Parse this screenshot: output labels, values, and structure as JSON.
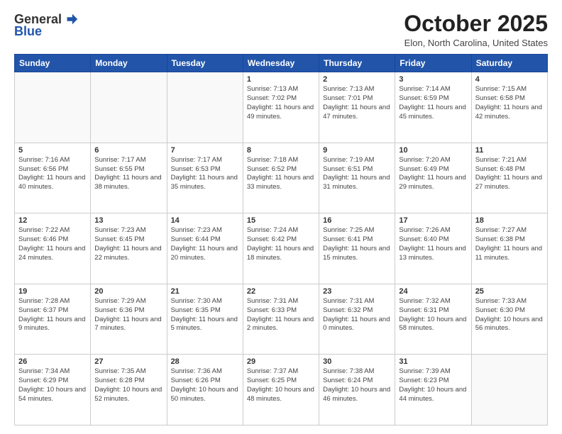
{
  "logo": {
    "line1": "General",
    "line2": "Blue"
  },
  "header": {
    "month": "October 2025",
    "location": "Elon, North Carolina, United States"
  },
  "days_of_week": [
    "Sunday",
    "Monday",
    "Tuesday",
    "Wednesday",
    "Thursday",
    "Friday",
    "Saturday"
  ],
  "weeks": [
    [
      {
        "day": "",
        "info": ""
      },
      {
        "day": "",
        "info": ""
      },
      {
        "day": "",
        "info": ""
      },
      {
        "day": "1",
        "info": "Sunrise: 7:13 AM\nSunset: 7:02 PM\nDaylight: 11 hours and 49 minutes."
      },
      {
        "day": "2",
        "info": "Sunrise: 7:13 AM\nSunset: 7:01 PM\nDaylight: 11 hours and 47 minutes."
      },
      {
        "day": "3",
        "info": "Sunrise: 7:14 AM\nSunset: 6:59 PM\nDaylight: 11 hours and 45 minutes."
      },
      {
        "day": "4",
        "info": "Sunrise: 7:15 AM\nSunset: 6:58 PM\nDaylight: 11 hours and 42 minutes."
      }
    ],
    [
      {
        "day": "5",
        "info": "Sunrise: 7:16 AM\nSunset: 6:56 PM\nDaylight: 11 hours and 40 minutes."
      },
      {
        "day": "6",
        "info": "Sunrise: 7:17 AM\nSunset: 6:55 PM\nDaylight: 11 hours and 38 minutes."
      },
      {
        "day": "7",
        "info": "Sunrise: 7:17 AM\nSunset: 6:53 PM\nDaylight: 11 hours and 35 minutes."
      },
      {
        "day": "8",
        "info": "Sunrise: 7:18 AM\nSunset: 6:52 PM\nDaylight: 11 hours and 33 minutes."
      },
      {
        "day": "9",
        "info": "Sunrise: 7:19 AM\nSunset: 6:51 PM\nDaylight: 11 hours and 31 minutes."
      },
      {
        "day": "10",
        "info": "Sunrise: 7:20 AM\nSunset: 6:49 PM\nDaylight: 11 hours and 29 minutes."
      },
      {
        "day": "11",
        "info": "Sunrise: 7:21 AM\nSunset: 6:48 PM\nDaylight: 11 hours and 27 minutes."
      }
    ],
    [
      {
        "day": "12",
        "info": "Sunrise: 7:22 AM\nSunset: 6:46 PM\nDaylight: 11 hours and 24 minutes."
      },
      {
        "day": "13",
        "info": "Sunrise: 7:23 AM\nSunset: 6:45 PM\nDaylight: 11 hours and 22 minutes."
      },
      {
        "day": "14",
        "info": "Sunrise: 7:23 AM\nSunset: 6:44 PM\nDaylight: 11 hours and 20 minutes."
      },
      {
        "day": "15",
        "info": "Sunrise: 7:24 AM\nSunset: 6:42 PM\nDaylight: 11 hours and 18 minutes."
      },
      {
        "day": "16",
        "info": "Sunrise: 7:25 AM\nSunset: 6:41 PM\nDaylight: 11 hours and 15 minutes."
      },
      {
        "day": "17",
        "info": "Sunrise: 7:26 AM\nSunset: 6:40 PM\nDaylight: 11 hours and 13 minutes."
      },
      {
        "day": "18",
        "info": "Sunrise: 7:27 AM\nSunset: 6:38 PM\nDaylight: 11 hours and 11 minutes."
      }
    ],
    [
      {
        "day": "19",
        "info": "Sunrise: 7:28 AM\nSunset: 6:37 PM\nDaylight: 11 hours and 9 minutes."
      },
      {
        "day": "20",
        "info": "Sunrise: 7:29 AM\nSunset: 6:36 PM\nDaylight: 11 hours and 7 minutes."
      },
      {
        "day": "21",
        "info": "Sunrise: 7:30 AM\nSunset: 6:35 PM\nDaylight: 11 hours and 5 minutes."
      },
      {
        "day": "22",
        "info": "Sunrise: 7:31 AM\nSunset: 6:33 PM\nDaylight: 11 hours and 2 minutes."
      },
      {
        "day": "23",
        "info": "Sunrise: 7:31 AM\nSunset: 6:32 PM\nDaylight: 11 hours and 0 minutes."
      },
      {
        "day": "24",
        "info": "Sunrise: 7:32 AM\nSunset: 6:31 PM\nDaylight: 10 hours and 58 minutes."
      },
      {
        "day": "25",
        "info": "Sunrise: 7:33 AM\nSunset: 6:30 PM\nDaylight: 10 hours and 56 minutes."
      }
    ],
    [
      {
        "day": "26",
        "info": "Sunrise: 7:34 AM\nSunset: 6:29 PM\nDaylight: 10 hours and 54 minutes."
      },
      {
        "day": "27",
        "info": "Sunrise: 7:35 AM\nSunset: 6:28 PM\nDaylight: 10 hours and 52 minutes."
      },
      {
        "day": "28",
        "info": "Sunrise: 7:36 AM\nSunset: 6:26 PM\nDaylight: 10 hours and 50 minutes."
      },
      {
        "day": "29",
        "info": "Sunrise: 7:37 AM\nSunset: 6:25 PM\nDaylight: 10 hours and 48 minutes."
      },
      {
        "day": "30",
        "info": "Sunrise: 7:38 AM\nSunset: 6:24 PM\nDaylight: 10 hours and 46 minutes."
      },
      {
        "day": "31",
        "info": "Sunrise: 7:39 AM\nSunset: 6:23 PM\nDaylight: 10 hours and 44 minutes."
      },
      {
        "day": "",
        "info": ""
      }
    ]
  ]
}
